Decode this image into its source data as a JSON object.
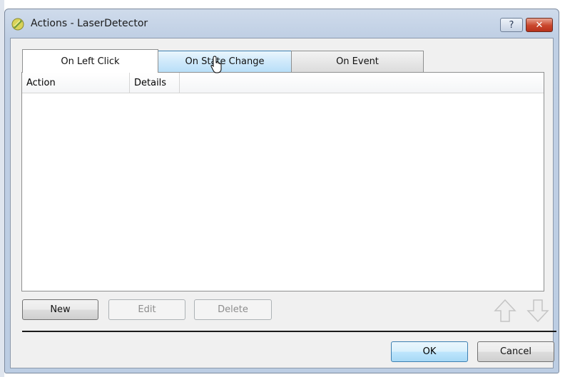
{
  "window": {
    "title": "Actions - LaserDetector",
    "help_label": "?",
    "close_label": "✕"
  },
  "tabs": [
    {
      "label": "On Left Click",
      "selected": true
    },
    {
      "label": "On State Change",
      "hovered": true
    },
    {
      "label": "On Event"
    }
  ],
  "list": {
    "columns": [
      "Action",
      "Details"
    ],
    "rows": []
  },
  "buttons": {
    "new": "New",
    "edit": "Edit",
    "delete": "Delete",
    "ok": "OK",
    "cancel": "Cancel"
  },
  "icons": {
    "app": "laser-detector-icon",
    "move_up": "arrow-up-icon",
    "move_down": "arrow-down-icon",
    "cursor": "mouse-cursor-icon"
  },
  "colors": {
    "titlebar": "#bfcfe4",
    "close_button": "#c9462c",
    "hover_tab": "#cfe9fb",
    "ok_border": "#3c7fb1"
  }
}
